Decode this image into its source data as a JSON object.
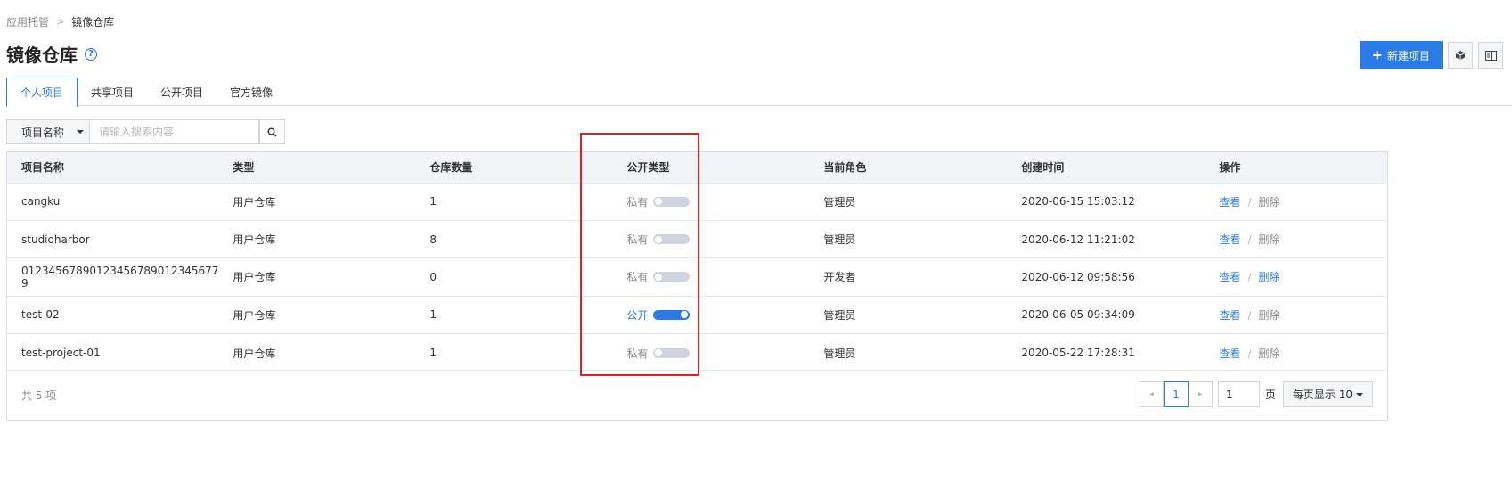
{
  "breadcrumb": {
    "parent": "应用托管",
    "separator": ">",
    "current": "镜像仓库"
  },
  "page": {
    "title": "镜像仓库",
    "help_icon": "question-circle-icon"
  },
  "toolbar": {
    "new_project_label": "新建项目",
    "icons": [
      "cube-icon",
      "book-icon"
    ]
  },
  "tabs": [
    {
      "label": "个人项目",
      "active": true
    },
    {
      "label": "共享项目",
      "active": false
    },
    {
      "label": "公开项目",
      "active": false
    },
    {
      "label": "官方镜像",
      "active": false
    }
  ],
  "search": {
    "field_select": "项目名称",
    "placeholder": "请输入搜索内容",
    "value": ""
  },
  "table": {
    "headers": [
      "项目名称",
      "类型",
      "仓库数量",
      "公开类型",
      "当前角色",
      "创建时间",
      "操作"
    ],
    "rows": [
      {
        "name": "cangku",
        "type": "用户仓库",
        "count": "1",
        "public_label": "私有",
        "public": false,
        "role": "管理员",
        "created": "2020-06-15 15:03:12",
        "view": "查看",
        "delete": "删除",
        "delete_enabled": false
      },
      {
        "name": "studioharbor",
        "type": "用户仓库",
        "count": "8",
        "public_label": "私有",
        "public": false,
        "role": "管理员",
        "created": "2020-06-12 11:21:02",
        "view": "查看",
        "delete": "删除",
        "delete_enabled": false
      },
      {
        "name": "01234567890123456789012345677 9",
        "type": "用户仓库",
        "count": "0",
        "public_label": "私有",
        "public": false,
        "role": "开发者",
        "created": "2020-06-12 09:58:56",
        "view": "查看",
        "delete": "删除",
        "delete_enabled": true
      },
      {
        "name": "test-02",
        "type": "用户仓库",
        "count": "1",
        "public_label": "公开",
        "public": true,
        "role": "管理员",
        "created": "2020-06-05 09:34:09",
        "view": "查看",
        "delete": "删除",
        "delete_enabled": false
      },
      {
        "name": "test-project-01",
        "type": "用户仓库",
        "count": "1",
        "public_label": "私有",
        "public": false,
        "role": "管理员",
        "created": "2020-05-22 17:28:31",
        "view": "查看",
        "delete": "删除",
        "delete_enabled": false
      }
    ],
    "op_separator": "/"
  },
  "footer": {
    "total": "共 5 项",
    "current_page": "1",
    "page_input": "1",
    "page_unit": "页",
    "page_size": "每页显示 10"
  },
  "colors": {
    "primary": "#2b7be6",
    "highlight": "#e02020"
  }
}
